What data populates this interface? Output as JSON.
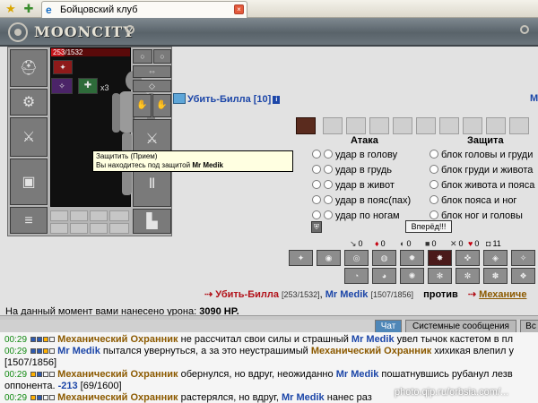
{
  "browser": {
    "tab_title": "Бойцовский клуб"
  },
  "header": {
    "logo": "MOONCITY"
  },
  "player": {
    "hp_text": "253/1532",
    "hp_fraction": 0.165,
    "buff_count": "x3"
  },
  "tooltip": {
    "line1": "Защитить (Прием)",
    "line2_prefix": "Вы находитесь под защитой",
    "line2_name": "Mr Medik"
  },
  "opponent": {
    "name": "Убить-Билла [10]",
    "info_badge": "i",
    "right_marker": "M"
  },
  "attack": {
    "title": "Атака",
    "options": [
      "удар в голову",
      "удар в грудь",
      "удар в живот",
      "удар в пояс(пах)",
      "удар по ногам"
    ]
  },
  "defense": {
    "title": "Защита",
    "options": [
      "блок головы и груди",
      "блок груди и живота",
      "блок живота и пояса",
      "блок пояса и ног",
      "блок ног и головы"
    ]
  },
  "buttons": {
    "forward": "Вперёд!!!"
  },
  "counters": [
    "0",
    "0",
    "0",
    "0",
    "0",
    "0",
    "11"
  ],
  "battle": {
    "left_name": "Убить-Билла",
    "left_hp": "[253/1532]",
    "ally_name": "Mr Medik",
    "ally_hp": "[1507/1856]",
    "vs": "против",
    "right_name": "Механиче"
  },
  "damage": {
    "label": "На данный момент вами нанесено урона:",
    "value": "3090 HP."
  },
  "chat_tabs": {
    "chat": "Чат",
    "system": "Системные сообщения",
    "all": "Вс"
  },
  "chat_lines": [
    {
      "time": "00:29",
      "pre": "",
      "a": "Механический Охранник",
      "mid": " не рассчитал свои силы и страшный ",
      "b": "Mr Medik",
      "post": " увел тычок кастетом в пл"
    },
    {
      "time": "00:29",
      "pre": "",
      "a": "Mr Medik",
      "mid": " пытался увернуться, а за это неустрашимый ",
      "b": "Механический Охранник",
      "post": " хихикая влепил у"
    },
    {
      "time": "",
      "pre": "[1507/1856]",
      "a": "",
      "mid": "",
      "b": "",
      "post": ""
    },
    {
      "time": "00:29",
      "pre": "",
      "a": "Механический Охранник",
      "mid": " обернулся, но вдруг, неожиданно ",
      "b": "Mr Medik",
      "post": " пошатнувшись рубанул лезв"
    },
    {
      "time": "",
      "pre": "оппонента. ",
      "a": "",
      "mid": "",
      "b": "-213",
      "post": " [69/1600]"
    },
    {
      "time": "00:29",
      "pre": "",
      "a": "Механический Охранник",
      "mid": " растерялся, но вдруг, ",
      "b": "Mr Medik",
      "post": " нанес раз"
    }
  ],
  "watermark": "photo.qip.ru/orbsia.com/..."
}
